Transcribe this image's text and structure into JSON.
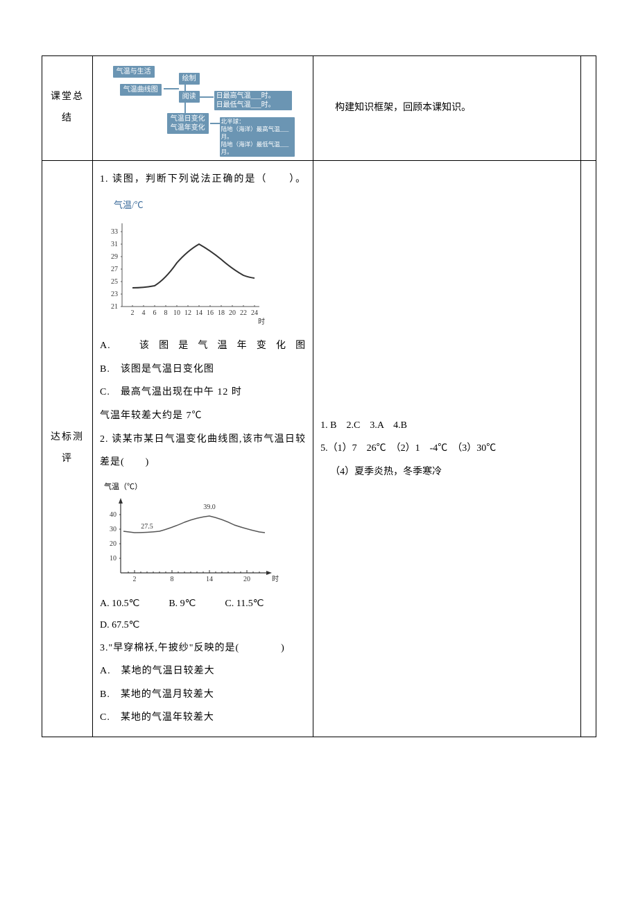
{
  "row1": {
    "label": "课堂总结",
    "diagram": {
      "b1": "气温与生活",
      "b2": "气温曲线图",
      "b3": "绘制",
      "b4": "阅读",
      "b5a": "日最高气温___时。",
      "b5b": "日最低气温___时。",
      "b6a": "气温日变化",
      "b6b": "气温年变化",
      "b7a": "北半球：",
      "b7b": "陆地（海洋）最高气温___月。",
      "b7c": "陆地（海洋）最低气温___月。"
    },
    "right": "构建知识框架，回顾本课知识。"
  },
  "row2": {
    "label": "达标测评",
    "q1": {
      "stem": "1. 读图，判断下列说法正确的是（　　）。",
      "ylabel": "气温/℃",
      "xlabel": "时",
      "optA": "A.　该图是气温年变化图",
      "optB": "B.　该图是气温日变化图",
      "optC": "C.　最高气温出现在中午 12 时",
      "optD": "气温年较差大约是 7℃"
    },
    "q2": {
      "stem": "2. 读某市某日气温变化曲线图,该市气温日较差是(　　)",
      "ylabel": "气温（℃）",
      "xlabel": "时",
      "peak": "39.0",
      "low": "27.5",
      "opts": "A. 10.5℃　　　B. 9℃　　　C. 11.5℃",
      "optD": "D. 67.5℃"
    },
    "q3": {
      "stem": "3.\"早穿棉袄,午披纱\"反映的是(　　　　)",
      "optA": "A.　某地的气温日较差大",
      "optB": "B.　某地的气温月较差大",
      "optC": "C.　某地的气温年较差大"
    },
    "answers": {
      "line1": "1. B　2.C　3.A　4.B",
      "line2": "5.（1）7　26℃　（2）1　-4℃　（3）30℃",
      "line3": "（4）夏季炎热，冬季寒冷"
    }
  },
  "chart_data": [
    {
      "type": "line",
      "title": "",
      "xlabel": "时",
      "ylabel": "气温/℃",
      "x": [
        2,
        4,
        6,
        8,
        10,
        12,
        14,
        16,
        18,
        20,
        22,
        24
      ],
      "y_ticks": [
        21,
        23,
        25,
        27,
        29,
        31,
        33
      ],
      "ylim": [
        21,
        33
      ],
      "series": [
        {
          "name": "气温",
          "x": [
            2,
            4,
            6,
            8,
            10,
            12,
            14,
            16,
            18,
            20,
            22,
            24
          ],
          "values": [
            24,
            24,
            24.3,
            25.5,
            28,
            30,
            31,
            30,
            28.5,
            27,
            26,
            25.5
          ]
        }
      ]
    },
    {
      "type": "line",
      "title": "",
      "xlabel": "时",
      "ylabel": "气温（℃）",
      "x_ticks": [
        2,
        8,
        14,
        20
      ],
      "y_ticks": [
        10,
        20,
        30,
        40
      ],
      "ylim": [
        0,
        45
      ],
      "annotations": [
        {
          "x": 14,
          "y": 39.0,
          "text": "39.0"
        },
        {
          "x": 4,
          "y": 27.5,
          "text": "27.5"
        }
      ],
      "series": [
        {
          "name": "气温",
          "x": [
            1,
            2,
            4,
            6,
            8,
            10,
            12,
            14,
            16,
            18,
            20,
            22,
            24
          ],
          "values": [
            28,
            27.5,
            27.5,
            28,
            29,
            32,
            37,
            39,
            37,
            34,
            31,
            29,
            28
          ]
        }
      ]
    }
  ]
}
